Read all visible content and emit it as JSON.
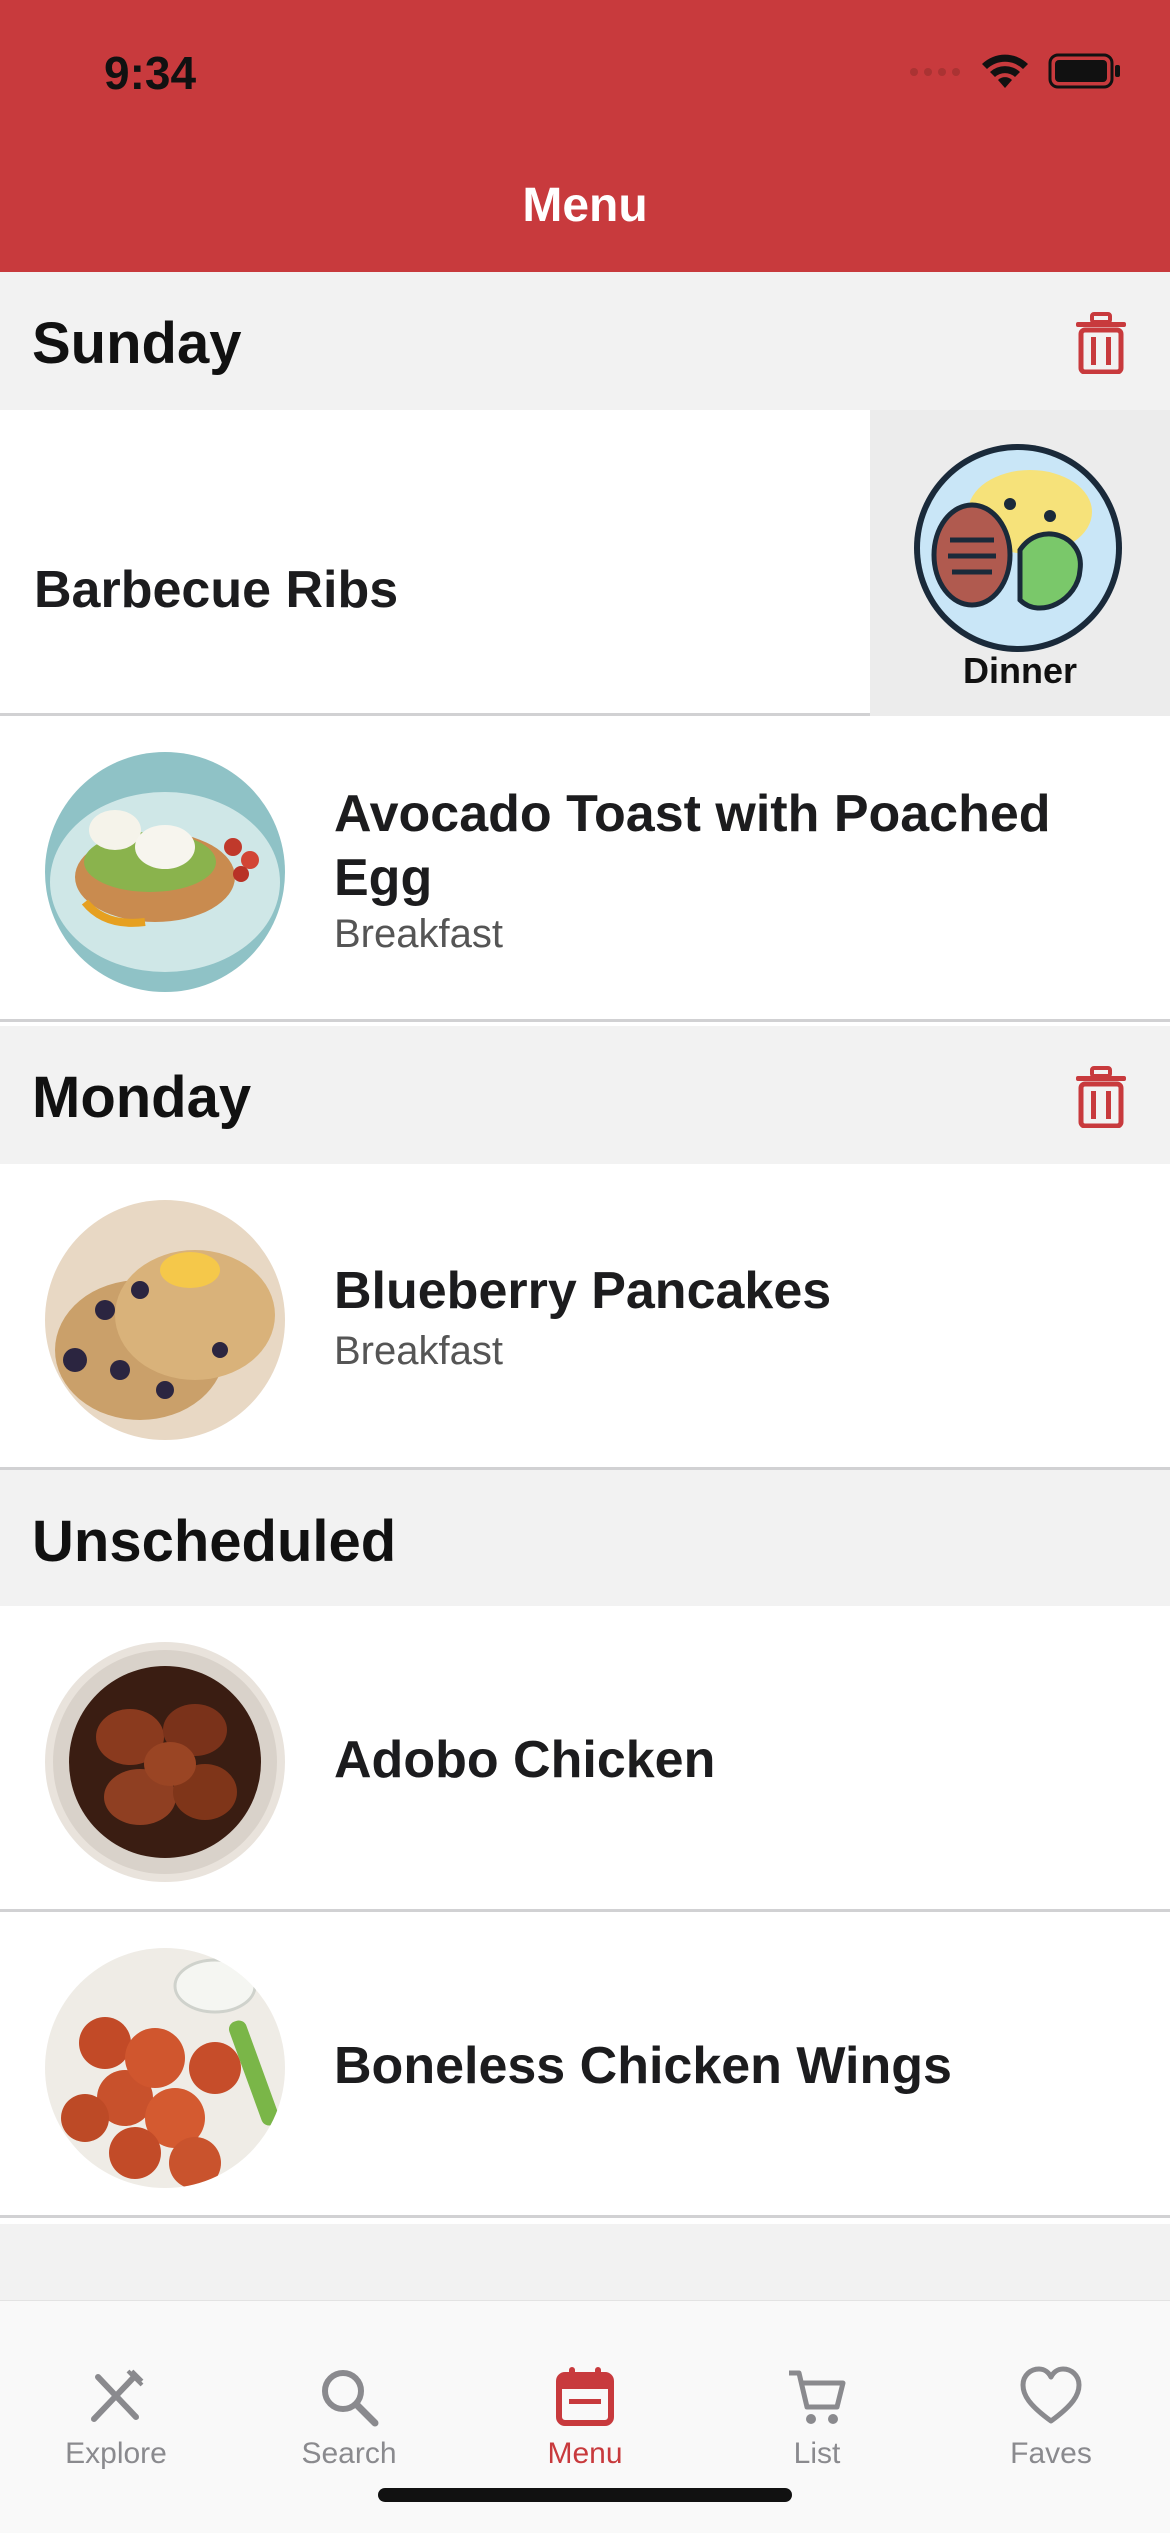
{
  "status": {
    "time": "9:34"
  },
  "nav": {
    "title": "Menu"
  },
  "sections": [
    {
      "title": "Sunday"
    },
    {
      "title": "Monday"
    },
    {
      "title": "Unscheduled"
    }
  ],
  "rows": {
    "ribs": {
      "title": "Barbecue Ribs",
      "meal": "Dinner"
    },
    "avocado": {
      "title": "Avocado Toast with Poached Egg",
      "subtitle": "Breakfast"
    },
    "pancakes": {
      "title": "Blueberry Pancakes",
      "subtitle": "Breakfast"
    },
    "adobo": {
      "title": "Adobo Chicken"
    },
    "wings": {
      "title": "Boneless Chicken Wings"
    }
  },
  "tabs": [
    {
      "label": "Explore",
      "icon": "fork-knife-icon"
    },
    {
      "label": "Search",
      "icon": "search-icon"
    },
    {
      "label": "Menu",
      "icon": "calendar-icon",
      "active": true
    },
    {
      "label": "List",
      "icon": "cart-icon"
    },
    {
      "label": "Faves",
      "icon": "heart-icon"
    }
  ],
  "colors": {
    "accent": "#c83a3d",
    "section_bg": "#f2f2f2",
    "inactive": "#8a8a8e"
  }
}
